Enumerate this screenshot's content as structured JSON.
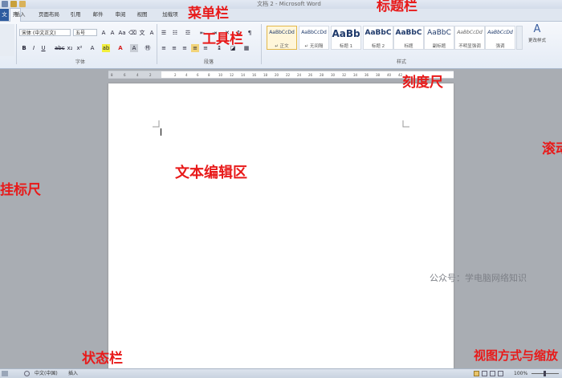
{
  "window": {
    "title": "文档 2 - Microsoft Word"
  },
  "tabs": [
    "文件",
    "开始",
    "插入",
    "页面布局",
    "引用",
    "邮件",
    "审阅",
    "视图",
    "加载项"
  ],
  "ribbon": {
    "font_name": "宋体 (中文正文)",
    "font_size": "五号",
    "group_font": "字体",
    "group_paragraph": "段落",
    "group_styles": "样式",
    "change_styles": "更改样式",
    "styles": [
      {
        "sample": "AaBbCcDd",
        "name": "↵ 正文"
      },
      {
        "sample": "AaBbCcDd",
        "name": "↵ 无间隔"
      },
      {
        "sample": "AaBb",
        "name": "标题 1"
      },
      {
        "sample": "AaBbC",
        "name": "标题 2"
      },
      {
        "sample": "AaBbC",
        "name": "标题"
      },
      {
        "sample": "AaBbC",
        "name": "副标题"
      },
      {
        "sample": "AaBbCcDd",
        "name": "不明显强调"
      },
      {
        "sample": "AaBbCcDd",
        "name": "强调"
      }
    ]
  },
  "ruler": {
    "ticks": [
      "8",
      "6",
      "4",
      "2",
      "2",
      "4",
      "6",
      "8",
      "10",
      "12",
      "14",
      "16",
      "18",
      "20",
      "22",
      "24",
      "26",
      "28",
      "30",
      "32",
      "34",
      "36",
      "38",
      "40",
      "42"
    ]
  },
  "status": {
    "language": "中文(中国)",
    "mode": "插入",
    "zoom": "100%"
  },
  "annotations": {
    "menubar": "菜单栏",
    "titlebar": "标题栏",
    "toolbar": "工具栏",
    "ruler": "刻度尺",
    "scroll": "滚动",
    "vertical_ruler": "挂标尺",
    "edit_area": "文本编辑区",
    "statusbar": "状态栏",
    "view_zoom": "视图方式与缩放"
  },
  "watermark": "公众号：学电脑网络知识"
}
